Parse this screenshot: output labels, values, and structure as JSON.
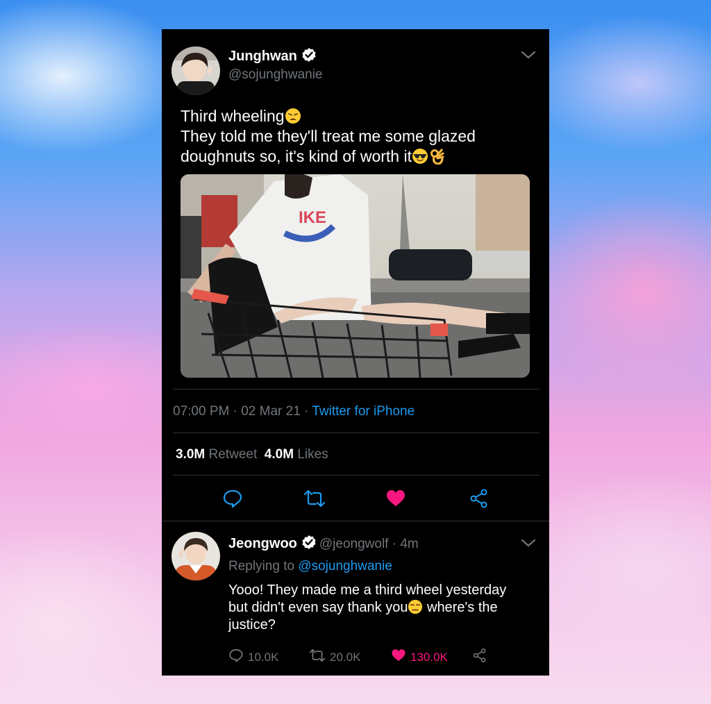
{
  "tweet": {
    "author_name": "Junghwan",
    "author_handle": "@sojunghwanie",
    "text_lines": [
      "Third wheeling",
      "They told me they'll treat me some glazed",
      "doughnuts so, it's kind of worth it"
    ],
    "time": "07:00 PM",
    "date": "02 Mar 21",
    "source": "Twitter for iPhone",
    "retweet_count": "3.0M",
    "retweet_label": "Retweet",
    "like_count": "4.0M",
    "like_label": "Likes"
  },
  "reply": {
    "author_name": "Jeongwoo",
    "author_handle": "@jeongwolf",
    "time_ago": "4m",
    "replying_prefix": "Replying to",
    "replying_to": "@sojunghwanie",
    "text_lines": [
      "Yooo! They made me a third wheel yesterday",
      "but didn't even say thank you",
      "justice?"
    ],
    "text_after_emoji": " where's the",
    "replies": "10.0K",
    "retweets": "20.0K",
    "likes": "130.0K"
  },
  "icons": {
    "verified": "verified-badge-icon",
    "chevron": "chevron-down-icon",
    "reply": "reply-icon",
    "retweet": "retweet-icon",
    "like": "heart-icon",
    "share": "share-icon"
  },
  "colors": {
    "accent": "#1d9bf0",
    "like": "#f91880",
    "muted": "#71767b"
  }
}
